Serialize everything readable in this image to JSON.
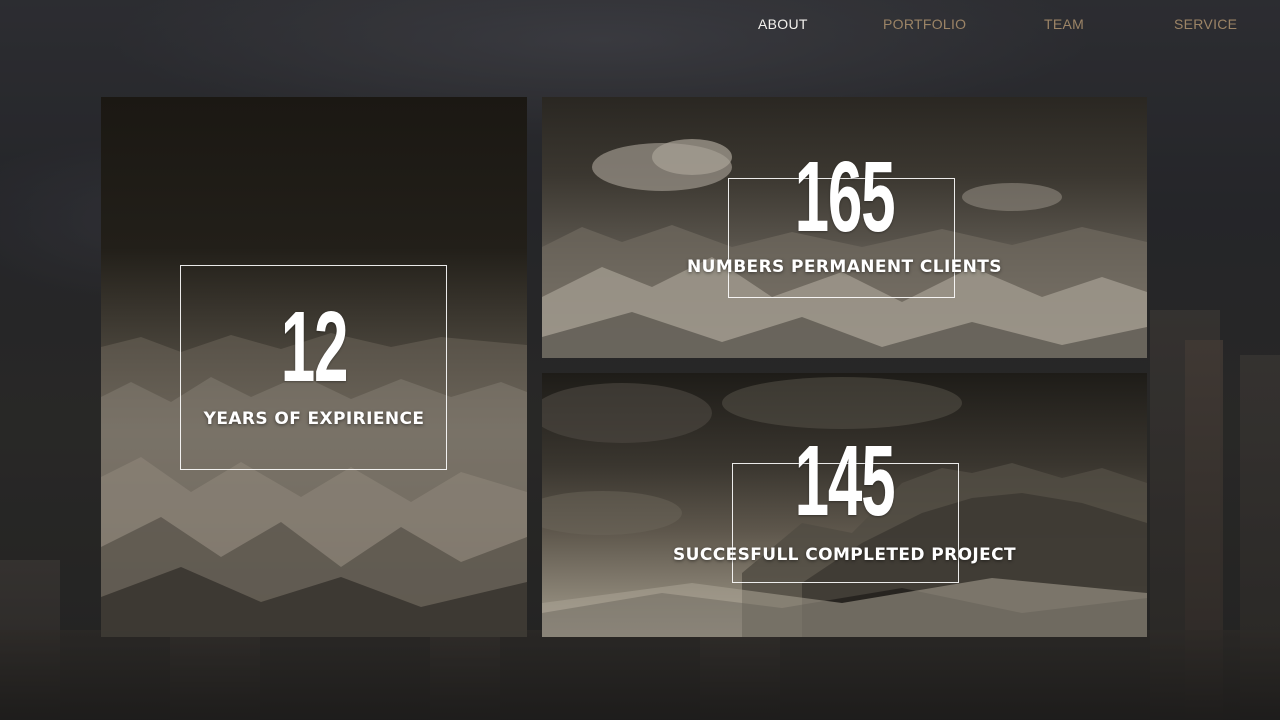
{
  "nav": {
    "items": [
      {
        "label": "ABOUT",
        "active": true
      },
      {
        "label": "PORTFOLIO",
        "active": false
      },
      {
        "label": "TEAM",
        "active": false
      },
      {
        "label": "SERVICE",
        "active": false
      }
    ]
  },
  "stats": {
    "years": {
      "number": "12",
      "label": "YEARS OF EXPIRIENCE"
    },
    "clients": {
      "number": "165",
      "label": "NUMBERS PERMANENT CLIENTS"
    },
    "projects": {
      "number": "145",
      "label": "SUCCESFULL COMPLETED PROJECT"
    }
  },
  "colors": {
    "nav_active": "#f4f2ee",
    "nav_inactive": "#9c8466",
    "text": "#ffffff"
  }
}
